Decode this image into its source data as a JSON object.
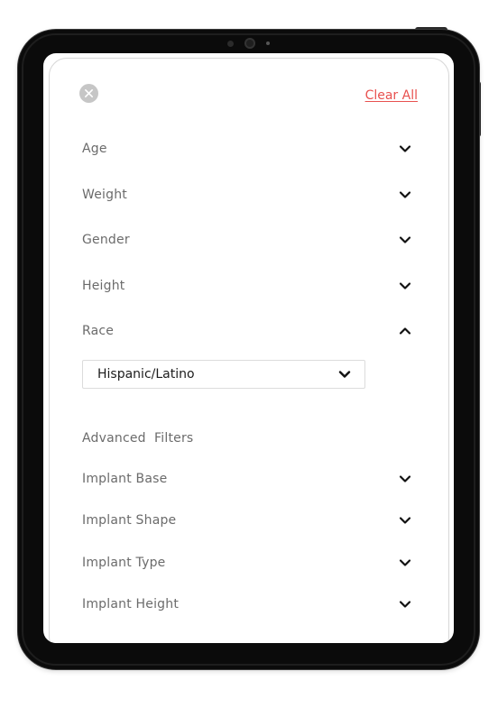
{
  "header": {
    "close_icon": "close-icon",
    "clear_all_label": "Clear All"
  },
  "filters": {
    "age": {
      "label": "Age",
      "state": "collapsed"
    },
    "weight": {
      "label": "Weight",
      "state": "collapsed"
    },
    "gender": {
      "label": "Gender",
      "state": "collapsed"
    },
    "height": {
      "label": "Height",
      "state": "collapsed"
    },
    "race": {
      "label": "Race",
      "state": "expanded",
      "selected_value": "Hispanic/Latino"
    }
  },
  "advanced": {
    "title": "Advanced  Filters",
    "items": {
      "implant_base": {
        "label": "Implant Base",
        "state": "collapsed"
      },
      "implant_shape": {
        "label": "Implant Shape",
        "state": "collapsed"
      },
      "implant_type": {
        "label": "Implant Type",
        "state": "collapsed"
      },
      "implant_height": {
        "label": "Implant Height",
        "state": "collapsed"
      }
    }
  },
  "colors": {
    "accent": "#e8514f",
    "label": "#6b6b6b",
    "close_bg": "#c6c6c6",
    "device": "#0b0b0b"
  }
}
